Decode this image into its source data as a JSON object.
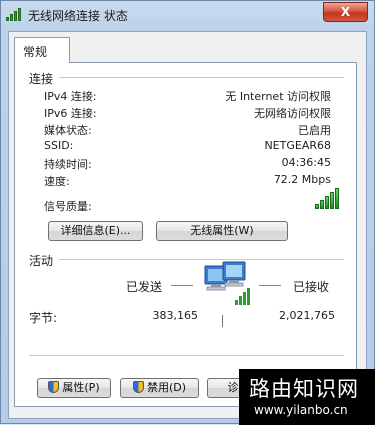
{
  "window": {
    "title": "无线网络连接 状态",
    "close_label": "X"
  },
  "tabs": [
    {
      "label": "常规"
    }
  ],
  "connection": {
    "title": "连接",
    "rows": [
      {
        "label": "IPv4 连接:",
        "value": "无 Internet 访问权限"
      },
      {
        "label": "IPv6 连接:",
        "value": "无网络访问权限"
      },
      {
        "label": "媒体状态:",
        "value": "已启用"
      },
      {
        "label": "SSID:",
        "value": "NETGEAR68"
      },
      {
        "label": "持续时间:",
        "value": "04:36:45"
      },
      {
        "label": "速度:",
        "value": "72.2 Mbps"
      }
    ],
    "signal_label": "信号质量:",
    "signal_bars_lit": 5,
    "signal_bars_total": 5,
    "details_button": "详细信息(E)...",
    "wireless_props_button": "无线属性(W)"
  },
  "activity": {
    "title": "活动",
    "sent_label": "已发送",
    "received_label": "已接收",
    "bytes_label": "字节:",
    "bytes_sent": "383,165",
    "bytes_received": "2,021,765"
  },
  "buttons": {
    "properties": "属性(P)",
    "disable": "禁用(D)",
    "diagnose": "诊断(G)"
  },
  "watermark": {
    "line1": "路由知识网",
    "line2": "www.yilanbo.cn"
  },
  "colors": {
    "signal_green": "#2f9a2f",
    "close_red": "#c3361f",
    "title_blue": "#bcd2ea"
  }
}
